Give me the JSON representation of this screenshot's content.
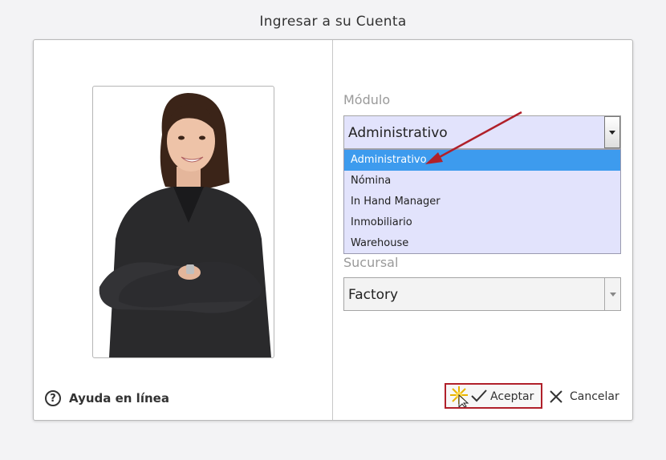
{
  "window": {
    "title": "Ingresar a su Cuenta"
  },
  "help": {
    "label": "Ayuda en línea",
    "icon": "question-circle-icon"
  },
  "modulo": {
    "label": "Módulo",
    "value": "Administrativo",
    "options": [
      "Administrativo",
      "Nómina",
      "In Hand Manager",
      "Inmobiliario",
      "Warehouse"
    ],
    "selected_index": 0
  },
  "sucursal": {
    "label": "Sucursal",
    "value": "Factory"
  },
  "actions": {
    "accept_label": "Aceptar",
    "cancel_label": "Cancelar"
  },
  "colors": {
    "dropdown_bg": "#e2e3fc",
    "selected_option": "#3d9bee",
    "annotation": "#b0202a"
  }
}
